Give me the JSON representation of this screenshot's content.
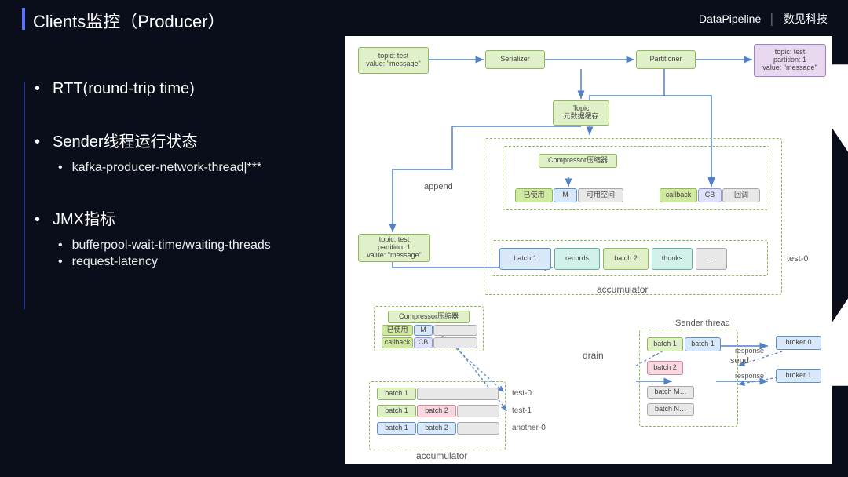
{
  "title": "Clients监控（Producer）",
  "brand": {
    "name": "DataPipeline",
    "tag": "数见科技"
  },
  "bullets": [
    {
      "label": "RTT(round-trip time)",
      "sub": []
    },
    {
      "label": "Sender线程运行状态",
      "sub": [
        "kafka-producer-network-thread|***"
      ]
    },
    {
      "label": "JMX指标",
      "sub": [
        "bufferpool-wait-time/waiting-threads",
        "request-latency"
      ]
    }
  ],
  "diagram": {
    "top_input": "topic: test\nvalue: \"message\"",
    "serializer": "Serializer",
    "partitioner": "Partitioner",
    "top_output": "topic: test\npartition: 1\nvalue: \"message\"",
    "topic_meta": "Topic\n元数据缓存",
    "compressor": "Compressor压缩器",
    "used": "已使用",
    "m": "M",
    "free": "可用空间",
    "callback": "callback",
    "cb": "CB",
    "huidiao": "回调",
    "append": "append",
    "append_detail": "topic: test\npartition: 1\nvalue: \"message\"",
    "batch1": "batch 1",
    "batch2": "batch 2",
    "records": "records",
    "thunks": "thunks",
    "dots": "…",
    "test0": "test-0",
    "test1": "test-1",
    "another0": "another-0",
    "accumulator": "accumulator",
    "compressor2": "Compressor压缩器",
    "drain": "drain",
    "send": "send",
    "response": "response",
    "sender_thread": "Sender thread",
    "batchM": "batch M…",
    "batchN": "batch N…",
    "broker0": "broker 0",
    "broker1": "broker 1"
  }
}
